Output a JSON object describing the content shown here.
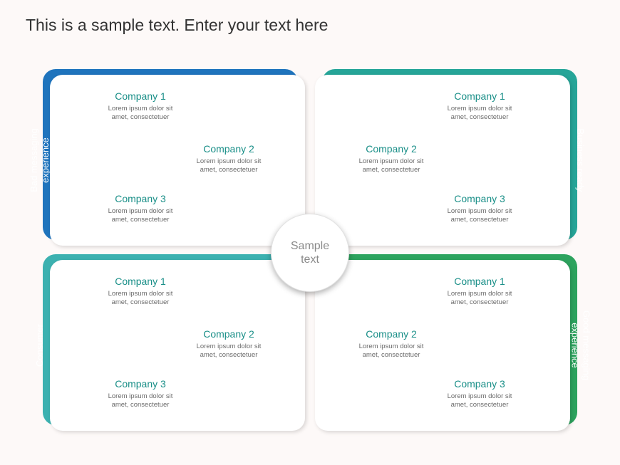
{
  "title": "This is a sample text. Enter your text here",
  "center": "Sample\ntext",
  "lorem": "Lorem ipsum dolor sit\namet, consectetuer",
  "quadrants": {
    "tl": {
      "label": "Bad messaging\nexperience",
      "companies": [
        {
          "name": "Company 1"
        },
        {
          "name": "Company 2"
        },
        {
          "name": "Company 3"
        }
      ]
    },
    "tr": {
      "label": "Business ready",
      "companies": [
        {
          "name": "Company 1"
        },
        {
          "name": "Company 2"
        },
        {
          "name": "Company 3"
        }
      ]
    },
    "bl": {
      "label": "Consumer",
      "companies": [
        {
          "name": "Company 1"
        },
        {
          "name": "Company 2"
        },
        {
          "name": "Company 3"
        }
      ]
    },
    "br": {
      "label": "Good messaging\nexperience",
      "companies": [
        {
          "name": "Company 1"
        },
        {
          "name": "Company 2"
        },
        {
          "name": "Company 3"
        }
      ]
    }
  },
  "colors": {
    "tl": "#1f74bd",
    "tr": "#26a598",
    "bl": "#3cb1b0",
    "br": "#2da35e"
  }
}
